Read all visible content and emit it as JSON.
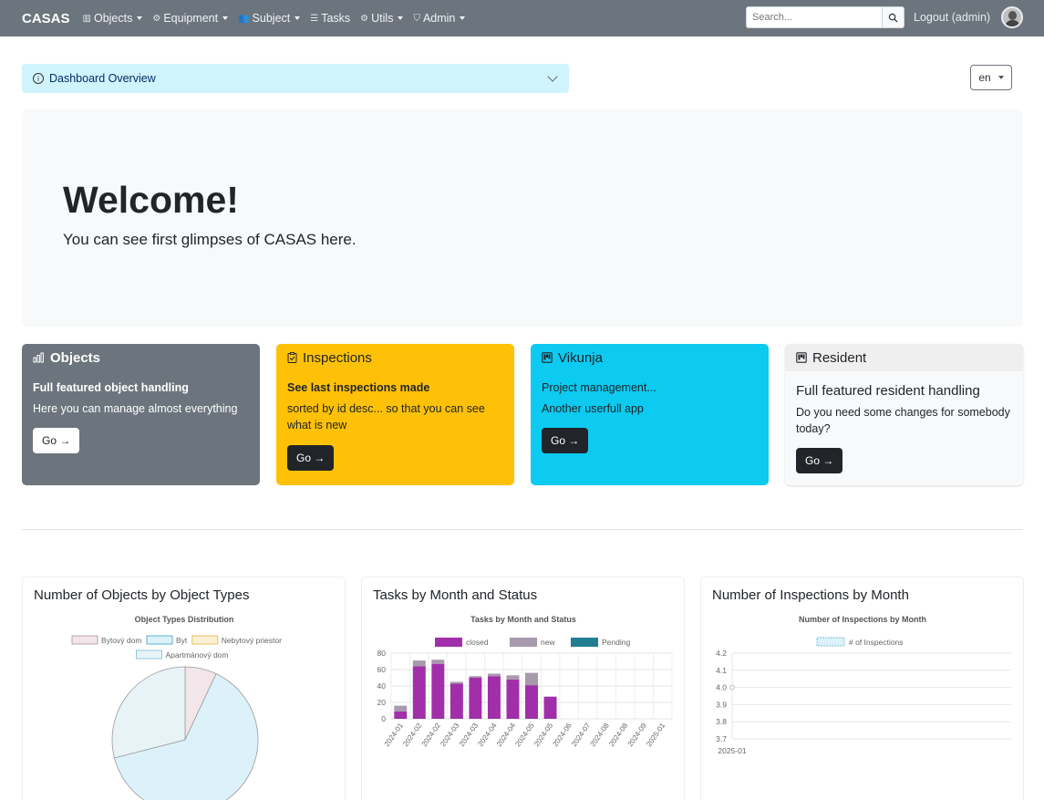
{
  "navbar": {
    "brand": "CASAS",
    "items": [
      {
        "label": "Objects",
        "icon": "building-icon"
      },
      {
        "label": "Equipment",
        "icon": "gear-icon"
      },
      {
        "label": "Subject",
        "icon": "people-icon"
      },
      {
        "label": "Tasks",
        "icon": "list-icon"
      },
      {
        "label": "Utils",
        "icon": "gear-icon"
      },
      {
        "label": "Admin",
        "icon": "shield-icon"
      }
    ],
    "search_placeholder": "Search...",
    "logout": "Logout (admin)"
  },
  "accordion": {
    "title": "Dashboard Overview"
  },
  "language": "en",
  "hero": {
    "title": "Welcome!",
    "subtitle": "You can see first glimpses of CASAS here."
  },
  "cards": [
    {
      "header": "Objects",
      "title": "Full featured object handling",
      "text": "Here you can manage almost everything",
      "button": "Go →"
    },
    {
      "header": "Inspections",
      "title": "See last inspections made",
      "text": "sorted by id desc... so that you can see what is new",
      "button": "Go →"
    },
    {
      "header": "Vikunja",
      "title": "Project management...",
      "text": "Another userfull app",
      "button": "Go →"
    },
    {
      "header": "Resident",
      "title": "Full featured resident handling",
      "text": "Do you need some changes for somebody today?",
      "button": "Go →"
    }
  ],
  "chart_cards": [
    {
      "heading": "Number of Objects by Object Types"
    },
    {
      "heading": "Tasks by Month and Status"
    },
    {
      "heading": "Number of Inspections by Month"
    }
  ],
  "chart_data": [
    {
      "type": "pie",
      "title": "Object Types Distribution",
      "categories": [
        "Bytový dom",
        "Byt",
        "Nebytový priestor",
        "Apartmánový dom"
      ],
      "values": [
        7,
        64,
        0,
        29
      ],
      "colors": [
        "#f2e6ea",
        "#dcf1fa",
        "#fbf0d4",
        "#e8f3f8"
      ],
      "legend": "top"
    },
    {
      "type": "bar",
      "title": "Tasks by Month and Status",
      "categories": [
        "2024-01",
        "2024-02",
        "2024-02",
        "2024-03",
        "2024-03",
        "2024-04",
        "2024-04",
        "2024-05",
        "2024-05",
        "2024-06",
        "2024-07",
        "2024-08",
        "2024-08",
        "2024-09",
        "2025-01"
      ],
      "series": [
        {
          "name": "closed",
          "color": "#a12faa",
          "values": [
            9,
            64,
            67,
            43,
            50,
            52,
            48,
            41,
            27,
            0,
            0,
            0,
            0,
            0,
            0
          ]
        },
        {
          "name": "new",
          "color": "#a69aac",
          "values": [
            7,
            7,
            5,
            2,
            2,
            3,
            5,
            15,
            0,
            0,
            0,
            0,
            0,
            0,
            0
          ]
        },
        {
          "name": "Pending",
          "color": "#237e91",
          "values": [
            0,
            0,
            0,
            0,
            0,
            0,
            0,
            0,
            0,
            0,
            0,
            0,
            0,
            0,
            0
          ]
        }
      ],
      "stacked": true,
      "ylim": [
        0,
        80
      ],
      "yticks": [
        0,
        20,
        40,
        60,
        80
      ],
      "grid": true,
      "legend": "top"
    },
    {
      "type": "line",
      "title": "Number of Inspections by Month",
      "x": [
        "2025-01"
      ],
      "series": [
        {
          "name": "# of Inspections",
          "values": [
            4.0
          ],
          "color": "#8ecae6"
        }
      ],
      "ylim": [
        3.7,
        4.2
      ],
      "yticks": [
        "3.7",
        "3.8",
        "3.9",
        "4.0",
        "4.1",
        "4.2"
      ],
      "grid": true,
      "legend": "top"
    }
  ]
}
